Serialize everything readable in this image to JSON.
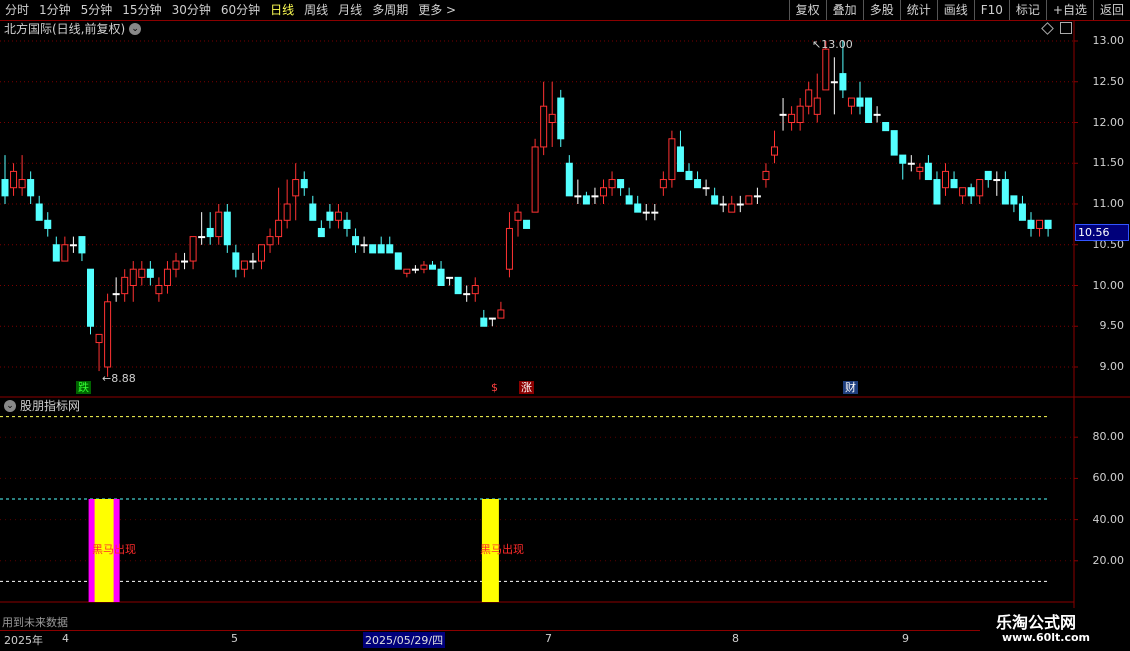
{
  "toolbar": {
    "periods": [
      "分时",
      "1分钟",
      "5分钟",
      "15分钟",
      "30分钟",
      "60分钟",
      "日线",
      "周线",
      "月线",
      "多周期",
      "更多 >"
    ],
    "active_period": "日线",
    "actions": [
      "复权",
      "叠加",
      "多股",
      "统计",
      "画线",
      "F10",
      "标记",
      "+自选",
      "返回"
    ]
  },
  "chart": {
    "title": "北方国际(日线,前复权)",
    "last_price": "10.56",
    "high_label": "13.00",
    "low_label": "8.88",
    "price_ticks": [
      "13.00",
      "12.50",
      "12.00",
      "11.50",
      "11.00",
      "10.50",
      "10.00",
      "9.50",
      "9.00"
    ],
    "markers": [
      {
        "text": "跌",
        "color": "#33ff33",
        "bg": "#006400"
      },
      {
        "text": "$",
        "color": "#ff4040",
        "bg": "#000000"
      },
      {
        "text": "涨",
        "color": "#ffffff",
        "bg": "#8b0000"
      },
      {
        "text": "财",
        "color": "#ffffff",
        "bg": "#1f3f7f"
      }
    ]
  },
  "indicator": {
    "title": "股朋指标网",
    "ticks": [
      "80.00",
      "60.00",
      "40.00",
      "20.00"
    ],
    "signal_text": "黑马出现",
    "note": "用到未来数据"
  },
  "dates": {
    "year": "2025年",
    "months": [
      "4",
      "5",
      "7",
      "8",
      "9"
    ],
    "selected": "2025/05/29/四"
  },
  "watermark": {
    "line1": "乐淘公式网",
    "line2": "www.60lt.com"
  },
  "chart_data": {
    "type": "candlestick",
    "title": "北方国际(日线,前复权)",
    "ylim": [
      8.8,
      13.1
    ],
    "colors": {
      "up": "#ff3232",
      "down": "#54ffff",
      "doji": "#ffffff"
    },
    "candles": [
      [
        11.3,
        11.6,
        11.0,
        11.1
      ],
      [
        11.2,
        11.5,
        11.1,
        11.4
      ],
      [
        11.2,
        11.6,
        11.1,
        11.3
      ],
      [
        11.3,
        11.4,
        11.0,
        11.1
      ],
      [
        11.0,
        11.1,
        10.8,
        10.8
      ],
      [
        10.8,
        10.9,
        10.6,
        10.7
      ],
      [
        10.5,
        10.6,
        10.3,
        10.3
      ],
      [
        10.3,
        10.6,
        10.3,
        10.5
      ],
      [
        10.5,
        10.6,
        10.4,
        10.5
      ],
      [
        10.6,
        10.6,
        10.3,
        10.4
      ],
      [
        10.2,
        10.2,
        9.4,
        9.5
      ],
      [
        9.3,
        9.4,
        8.95,
        9.4
      ],
      [
        9.0,
        9.9,
        8.88,
        9.8
      ],
      [
        9.9,
        10.1,
        9.8,
        9.9
      ],
      [
        9.9,
        10.2,
        9.8,
        10.1
      ],
      [
        10.0,
        10.3,
        9.8,
        10.2
      ],
      [
        10.1,
        10.3,
        10.0,
        10.2
      ],
      [
        10.2,
        10.3,
        10.0,
        10.1
      ],
      [
        9.9,
        10.1,
        9.8,
        10.0
      ],
      [
        10.0,
        10.3,
        9.9,
        10.2
      ],
      [
        10.2,
        10.4,
        10.1,
        10.3
      ],
      [
        10.3,
        10.4,
        10.2,
        10.3
      ],
      [
        10.3,
        10.6,
        10.2,
        10.6
      ],
      [
        10.6,
        10.9,
        10.5,
        10.6
      ],
      [
        10.7,
        10.9,
        10.5,
        10.6
      ],
      [
        10.6,
        11.0,
        10.5,
        10.9
      ],
      [
        10.9,
        11.0,
        10.4,
        10.5
      ],
      [
        10.4,
        10.5,
        10.1,
        10.2
      ],
      [
        10.2,
        10.3,
        10.1,
        10.3
      ],
      [
        10.3,
        10.4,
        10.2,
        10.3
      ],
      [
        10.3,
        10.5,
        10.2,
        10.5
      ],
      [
        10.5,
        10.7,
        10.4,
        10.6
      ],
      [
        10.6,
        11.2,
        10.5,
        10.8
      ],
      [
        10.8,
        11.3,
        10.7,
        11.0
      ],
      [
        11.1,
        11.5,
        10.8,
        11.3
      ],
      [
        11.3,
        11.4,
        11.1,
        11.2
      ],
      [
        11.0,
        11.1,
        10.8,
        10.8
      ],
      [
        10.7,
        10.8,
        10.6,
        10.6
      ],
      [
        10.9,
        11.0,
        10.7,
        10.8
      ],
      [
        10.8,
        11.0,
        10.7,
        10.9
      ],
      [
        10.8,
        10.9,
        10.6,
        10.7
      ],
      [
        10.6,
        10.7,
        10.4,
        10.5
      ],
      [
        10.5,
        10.6,
        10.4,
        10.5
      ],
      [
        10.5,
        10.5,
        10.4,
        10.4
      ],
      [
        10.5,
        10.6,
        10.4,
        10.4
      ],
      [
        10.5,
        10.6,
        10.4,
        10.4
      ],
      [
        10.4,
        10.4,
        10.2,
        10.2
      ],
      [
        10.15,
        10.2,
        10.1,
        10.2
      ],
      [
        10.2,
        10.25,
        10.15,
        10.2
      ],
      [
        10.2,
        10.3,
        10.15,
        10.25
      ],
      [
        10.25,
        10.3,
        10.2,
        10.2
      ],
      [
        10.2,
        10.3,
        10.0,
        10.0
      ],
      [
        10.1,
        10.1,
        10.0,
        10.1
      ],
      [
        10.1,
        10.1,
        9.9,
        9.9
      ],
      [
        9.9,
        10.0,
        9.8,
        9.9
      ],
      [
        9.9,
        10.1,
        9.8,
        10.0
      ],
      [
        9.6,
        9.7,
        9.5,
        9.5
      ],
      [
        9.6,
        9.6,
        9.5,
        9.6
      ],
      [
        9.6,
        9.8,
        9.6,
        9.7
      ],
      [
        10.2,
        10.9,
        10.1,
        10.7
      ],
      [
        10.8,
        11.0,
        10.6,
        10.9
      ],
      [
        10.8,
        10.8,
        10.7,
        10.7
      ],
      [
        10.9,
        11.8,
        10.9,
        11.7
      ],
      [
        11.7,
        12.5,
        11.6,
        12.2
      ],
      [
        12.0,
        12.5,
        11.7,
        12.1
      ],
      [
        12.3,
        12.4,
        11.7,
        11.8
      ],
      [
        11.5,
        11.6,
        11.1,
        11.1
      ],
      [
        11.1,
        11.3,
        11.0,
        11.1
      ],
      [
        11.1,
        11.15,
        11.0,
        11.0
      ],
      [
        11.1,
        11.2,
        11.0,
        11.1
      ],
      [
        11.1,
        11.3,
        11.0,
        11.2
      ],
      [
        11.2,
        11.4,
        11.1,
        11.3
      ],
      [
        11.3,
        11.3,
        11.1,
        11.2
      ],
      [
        11.1,
        11.2,
        11.0,
        11.0
      ],
      [
        11.0,
        11.1,
        10.9,
        10.9
      ],
      [
        10.9,
        11.0,
        10.8,
        10.9
      ],
      [
        10.9,
        11.0,
        10.8,
        10.9
      ],
      [
        11.2,
        11.4,
        11.1,
        11.3
      ],
      [
        11.3,
        11.9,
        11.2,
        11.8
      ],
      [
        11.7,
        11.9,
        11.4,
        11.4
      ],
      [
        11.4,
        11.5,
        11.3,
        11.3
      ],
      [
        11.3,
        11.4,
        11.2,
        11.2
      ],
      [
        11.2,
        11.3,
        11.1,
        11.2
      ],
      [
        11.1,
        11.2,
        11.0,
        11.0
      ],
      [
        11.0,
        11.1,
        10.9,
        11.0
      ],
      [
        10.9,
        11.1,
        10.9,
        11.0
      ],
      [
        11.0,
        11.1,
        10.9,
        11.0
      ],
      [
        11.0,
        11.1,
        11.0,
        11.1
      ],
      [
        11.1,
        11.2,
        11.0,
        11.1
      ],
      [
        11.3,
        11.5,
        11.2,
        11.4
      ],
      [
        11.6,
        11.9,
        11.5,
        11.7
      ],
      [
        12.1,
        12.3,
        11.9,
        12.1
      ],
      [
        12.0,
        12.2,
        11.9,
        12.1
      ],
      [
        12.0,
        12.3,
        11.9,
        12.2
      ],
      [
        12.2,
        12.5,
        12.1,
        12.4
      ],
      [
        12.1,
        12.6,
        12.0,
        12.3
      ],
      [
        12.4,
        13.0,
        12.4,
        12.9
      ],
      [
        12.5,
        12.8,
        12.1,
        12.5
      ],
      [
        12.6,
        13.0,
        12.3,
        12.4
      ],
      [
        12.2,
        12.3,
        12.1,
        12.3
      ],
      [
        12.3,
        12.5,
        12.1,
        12.2
      ],
      [
        12.3,
        12.3,
        12.0,
        12.0
      ],
      [
        12.1,
        12.2,
        12.0,
        12.1
      ],
      [
        12.0,
        12.0,
        11.9,
        11.9
      ],
      [
        11.9,
        11.9,
        11.6,
        11.6
      ],
      [
        11.6,
        11.6,
        11.3,
        11.5
      ],
      [
        11.5,
        11.6,
        11.4,
        11.5
      ],
      [
        11.4,
        11.5,
        11.3,
        11.45
      ],
      [
        11.5,
        11.6,
        11.3,
        11.3
      ],
      [
        11.3,
        11.4,
        11.0,
        11.0
      ],
      [
        11.2,
        11.5,
        11.1,
        11.4
      ],
      [
        11.3,
        11.4,
        11.2,
        11.2
      ],
      [
        11.1,
        11.2,
        11.0,
        11.2
      ],
      [
        11.2,
        11.25,
        11.0,
        11.1
      ],
      [
        11.1,
        11.3,
        11.0,
        11.3
      ],
      [
        11.4,
        11.4,
        11.2,
        11.3
      ],
      [
        11.3,
        11.4,
        11.1,
        11.3
      ],
      [
        11.3,
        11.4,
        11.0,
        11.0
      ],
      [
        11.1,
        11.1,
        10.9,
        11.0
      ],
      [
        11.0,
        11.1,
        10.8,
        10.8
      ],
      [
        10.8,
        10.9,
        10.6,
        10.7
      ],
      [
        10.7,
        10.8,
        10.6,
        10.8
      ],
      [
        10.8,
        10.8,
        10.6,
        10.7
      ]
    ],
    "indicator": {
      "lines": [
        {
          "value": 90,
          "color": "#ffff54"
        },
        {
          "value": 50,
          "color": "#54ffff"
        },
        {
          "value": 10,
          "color": "#ffffff"
        }
      ],
      "signals": [
        {
          "candle_index": 12,
          "value": 50,
          "text": "黑马出现",
          "outer_color": "#ff00ff",
          "inner_color": "#ffff00"
        },
        {
          "candle_index": 58,
          "value": 50,
          "text": "黑马出现",
          "outer_color": "#ffff00",
          "inner_color": "#ffff00"
        }
      ]
    }
  }
}
